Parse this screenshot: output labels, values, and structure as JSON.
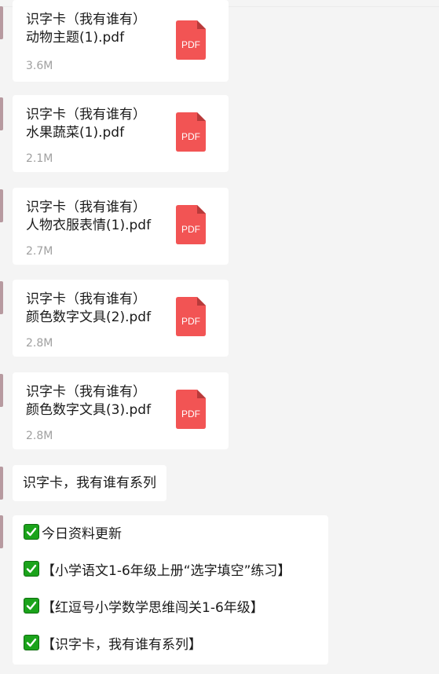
{
  "files": [
    {
      "name_line1": "识字卡（我有谁有）",
      "name_line2": "动物主题(1).pdf",
      "size": "3.6M",
      "icon": "pdf-icon",
      "icon_label": "PDF"
    },
    {
      "name_line1": "识字卡（我有谁有）",
      "name_line2": "水果蔬菜(1).pdf",
      "size": "2.1M",
      "icon": "pdf-icon",
      "icon_label": "PDF"
    },
    {
      "name_line1": "识字卡（我有谁有）",
      "name_line2": "人物衣服表情(1).pdf",
      "size": "2.7M",
      "icon": "pdf-icon",
      "icon_label": "PDF"
    },
    {
      "name_line1": "识字卡（我有谁有）",
      "name_line2": "颜色数字文具(2).pdf",
      "size": "2.8M",
      "icon": "pdf-icon",
      "icon_label": "PDF"
    },
    {
      "name_line1": "识字卡（我有谁有）",
      "name_line2": "颜色数字文具(3).pdf",
      "size": "2.8M",
      "icon": "pdf-icon",
      "icon_label": "PDF"
    }
  ],
  "text_message": "识字卡，我有谁有系列",
  "list_message": [
    {
      "icon": "check-mark-icon",
      "text": "今日资料更新"
    },
    {
      "icon": "check-mark-icon",
      "text": "【小学语文1-6年级上册“选字填空”练习】"
    },
    {
      "icon": "check-mark-icon",
      "text": "【红逗号小学数学思维闯关1-6年级】"
    },
    {
      "icon": "check-mark-icon",
      "text": "【识字卡，我有谁有系列】"
    }
  ],
  "colors": {
    "background": "#f4f4f4",
    "bubble": "#ffffff",
    "pdf_red": "#f25454",
    "pdf_fold": "#b83a3a",
    "check_green": "#1ba31b",
    "size_text": "#a0a0a0"
  }
}
